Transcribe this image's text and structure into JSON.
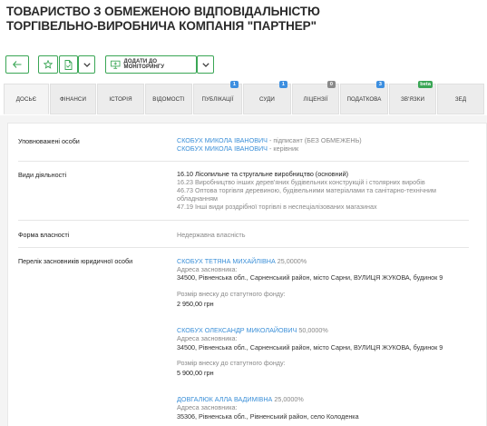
{
  "company": {
    "title_line1": "ТОВАРИСТВО З ОБМЕЖЕНОЮ ВІДПОВІДАЛЬНІСТЮ",
    "title_line2": "ТОРГІВЕЛЬНО-ВИРОБНИЧА КОМПАНІЯ \"ПАРТНЕР\""
  },
  "toolbar": {
    "monitor_label": "ДОДАТИ ДО МОНІТОРИНГУ",
    "icons": [
      "arrow-left-icon",
      "star-icon",
      "document-export-icon",
      "chevron-down-icon",
      "monitor-add-icon",
      "chevron-down-icon"
    ]
  },
  "tabs": [
    {
      "label": "ДОСЬЄ",
      "active": true
    },
    {
      "label": "ФІНАНСИ"
    },
    {
      "label": "ІСТОРІЯ"
    },
    {
      "label": "ВІДОМОСТІ"
    },
    {
      "label": "ПУБЛІКАЦІЇ",
      "badge": "1"
    },
    {
      "label": "СУДИ",
      "badge": "1"
    },
    {
      "label": "ЛІЦЕНЗІЇ",
      "badge": "0"
    },
    {
      "label": "ПОДАТКОВА",
      "badge": "3"
    },
    {
      "label": "ЗВ'ЯЗКИ",
      "badge": "beta"
    },
    {
      "label": "ЗЕД"
    }
  ],
  "colors": {
    "accent": "#3aa655",
    "link": "#3a8fd8",
    "badge_blue": "#3d8fe0",
    "badge_gray": "#8a8a8a"
  },
  "sections": {
    "authorized": {
      "label": "Уповноважені особи",
      "items": [
        {
          "name": "СКОБУХ МИКОЛА ІВАНОВИЧ",
          "role": " - підписант (БЕЗ ОБМЕЖЕНЬ)"
        },
        {
          "name": "СКОБУХ МИКОЛА ІВАНОВИЧ",
          "role": " - керівник"
        }
      ]
    },
    "activities": {
      "label": "Види діяльності",
      "items": [
        "16.10 Лісопильне та стругальне виробництво (основний)",
        "16.23 Виробництво інших дерев'яних будівельних конструкцій і столярних виробів",
        "46.73 Оптова торгівля деревиною, будівельними матеріалами та санітарно-технічним",
        "обладнанням",
        "47.19 Інші види роздрібної торгівлі в неспеціалізованих магазинах"
      ]
    },
    "ownership": {
      "label": "Форма власності",
      "value": "Недержавна власність"
    },
    "founders": {
      "label": "Перелік засновників юридичної особи",
      "address_label": "Адреса засновника:",
      "contribution_label": "Розмір внеску до статутного фонду:",
      "items": [
        {
          "name": "СКОБУХ ТЕТЯНА МИХАЙЛІВНА",
          "share": " 25,0000%",
          "address": "34500, Рівненська обл., Сарненський район, місто Сарни, ВУЛИЦЯ ЖУКОВА, будинок 9",
          "contribution": "2 950,00 грн"
        },
        {
          "name": "СКОБУХ ОЛЕКСАНДР МИКОЛАЙОВИЧ",
          "share": " 50,0000%",
          "address": "34500, Рівненська обл., Сарненський район, місто Сарни, ВУЛИЦЯ ЖУКОВА, будинок 9",
          "contribution": "5 900,00 грн"
        },
        {
          "name": "ДОВГАЛЮК АЛЛА ВАДИМІВНА",
          "share": " 25,0000%",
          "address": "35306, Рівненська обл., Рівненський район, село Колоденка"
        }
      ]
    }
  }
}
